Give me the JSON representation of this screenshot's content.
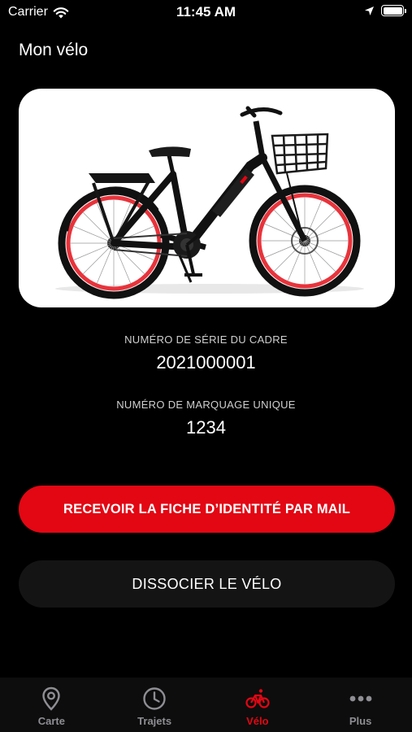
{
  "status_bar": {
    "carrier": "Carrier",
    "time": "11:45 AM"
  },
  "page": {
    "title": "Mon vélo"
  },
  "bike": {
    "frame_serial_label": "NUMÉRO DE SÉRIE DU CADRE",
    "frame_serial_value": "2021000001",
    "marking_label": "NUMÉRO DE MARQUAGE UNIQUE",
    "marking_value": "1234"
  },
  "actions": {
    "receive_sheet": "RECEVOIR LA FICHE D’IDENTITÉ PAR MAIL",
    "dissociate": "DISSOCIER LE VÉLO"
  },
  "tabs": [
    {
      "label": "Carte",
      "icon": "map-pin-icon"
    },
    {
      "label": "Trajets",
      "icon": "clock-icon"
    },
    {
      "label": "Vélo",
      "icon": "bicycle-icon",
      "active": true
    },
    {
      "label": "Plus",
      "icon": "more-icon"
    }
  ],
  "colors": {
    "accent": "#e30613",
    "background": "#000000",
    "inactive_tab": "#8e8e93",
    "secondary_button": "#141414"
  }
}
